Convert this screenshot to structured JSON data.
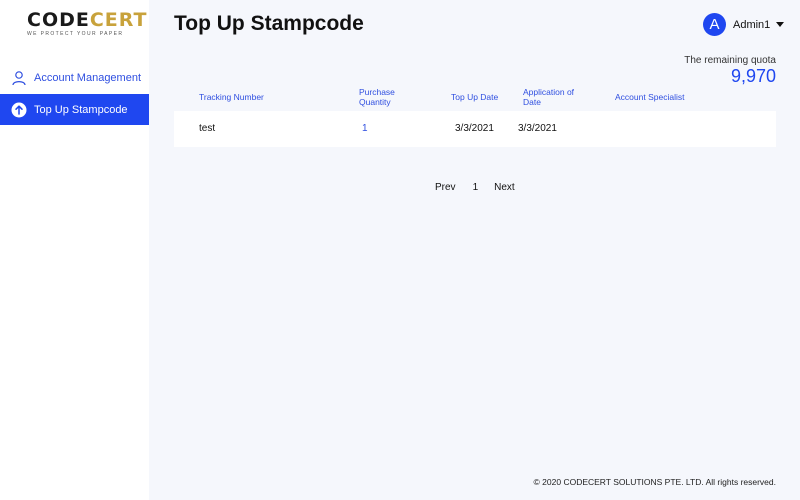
{
  "brand": {
    "logo_main_left": "CODE",
    "logo_main_right": "CERT",
    "tagline": "WE PROTECT YOUR PAPER",
    "primary_color": "#1f47f0",
    "gold_color": "#c8a23b"
  },
  "sidebar": {
    "items": [
      {
        "label": "Account Management",
        "icon": "user-icon",
        "active": false
      },
      {
        "label": "Top Up Stampcode",
        "icon": "arrow-up-circle-icon",
        "active": true
      }
    ]
  },
  "header": {
    "title": "Top Up Stampcode",
    "user": {
      "initial": "A",
      "name": "Admin1"
    }
  },
  "quota": {
    "label": "The remaining quota",
    "value": "9,970"
  },
  "table": {
    "columns": [
      "Tracking Number",
      "Purchase Quantity",
      "Top Up Date",
      "Application of Date",
      "Account Specialist"
    ],
    "rows": [
      {
        "tracking": "test",
        "quantity": "1",
        "top_up_date": "3/3/2021",
        "application_date": "3/3/2021",
        "specialist": ""
      }
    ]
  },
  "pagination": {
    "prev": "Prev",
    "current": "1",
    "next": "Next"
  },
  "footer": {
    "copyright": "© 2020 CODECERT SOLUTIONS PTE. LTD. All rights reserved."
  }
}
